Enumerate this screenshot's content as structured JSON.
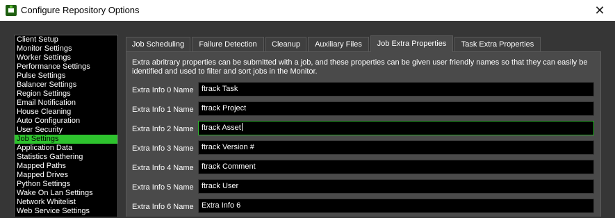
{
  "window": {
    "title": "Configure Repository Options",
    "close_glyph": "✕"
  },
  "sidebar": {
    "items": [
      {
        "label": "Client Setup"
      },
      {
        "label": "Monitor Settings"
      },
      {
        "label": "Worker Settings"
      },
      {
        "label": "Performance Settings"
      },
      {
        "label": "Pulse Settings"
      },
      {
        "label": "Balancer Settings"
      },
      {
        "label": "Region Settings"
      },
      {
        "label": "Email Notification"
      },
      {
        "label": "House Cleaning"
      },
      {
        "label": "Auto Configuration"
      },
      {
        "label": "User Security"
      },
      {
        "label": "Job Settings",
        "selected": true
      },
      {
        "label": "Application Data"
      },
      {
        "label": "Statistics Gathering"
      },
      {
        "label": "Mapped Paths"
      },
      {
        "label": "Mapped Drives"
      },
      {
        "label": "Python Settings"
      },
      {
        "label": "Wake On Lan Settings"
      },
      {
        "label": "Network Whitelist"
      },
      {
        "label": "Web Service Settings"
      }
    ]
  },
  "tabs": [
    {
      "label": "Job Scheduling"
    },
    {
      "label": "Failure Detection"
    },
    {
      "label": "Cleanup"
    },
    {
      "label": "Auxiliary Files"
    },
    {
      "label": "Job Extra Properties",
      "active": true
    },
    {
      "label": "Task Extra Properties"
    }
  ],
  "panel": {
    "description": "Extra abritrary properties can be submitted with a job, and these properties can be given user friendly names so that they can easily be identified and used to filter and sort jobs in the Monitor.",
    "rows": [
      {
        "label": "Extra Info 0 Name",
        "value": "ftrack Task"
      },
      {
        "label": "Extra Info 1 Name",
        "value": "ftrack Project"
      },
      {
        "label": "Extra Info 2 Name",
        "value": "ftrack Asset",
        "focused": true
      },
      {
        "label": "Extra Info 3 Name",
        "value": "ftrack Version #"
      },
      {
        "label": "Extra Info 4 Name",
        "value": "ftrack Comment"
      },
      {
        "label": "Extra Info 5 Name",
        "value": "ftrack User"
      },
      {
        "label": "Extra Info 6 Name",
        "value": "Extra Info 6"
      }
    ]
  },
  "colors": {
    "accent_green": "#2ec32e",
    "focus_border": "#2fb52f",
    "background": "#353535",
    "panel": "#4a4a4a"
  }
}
